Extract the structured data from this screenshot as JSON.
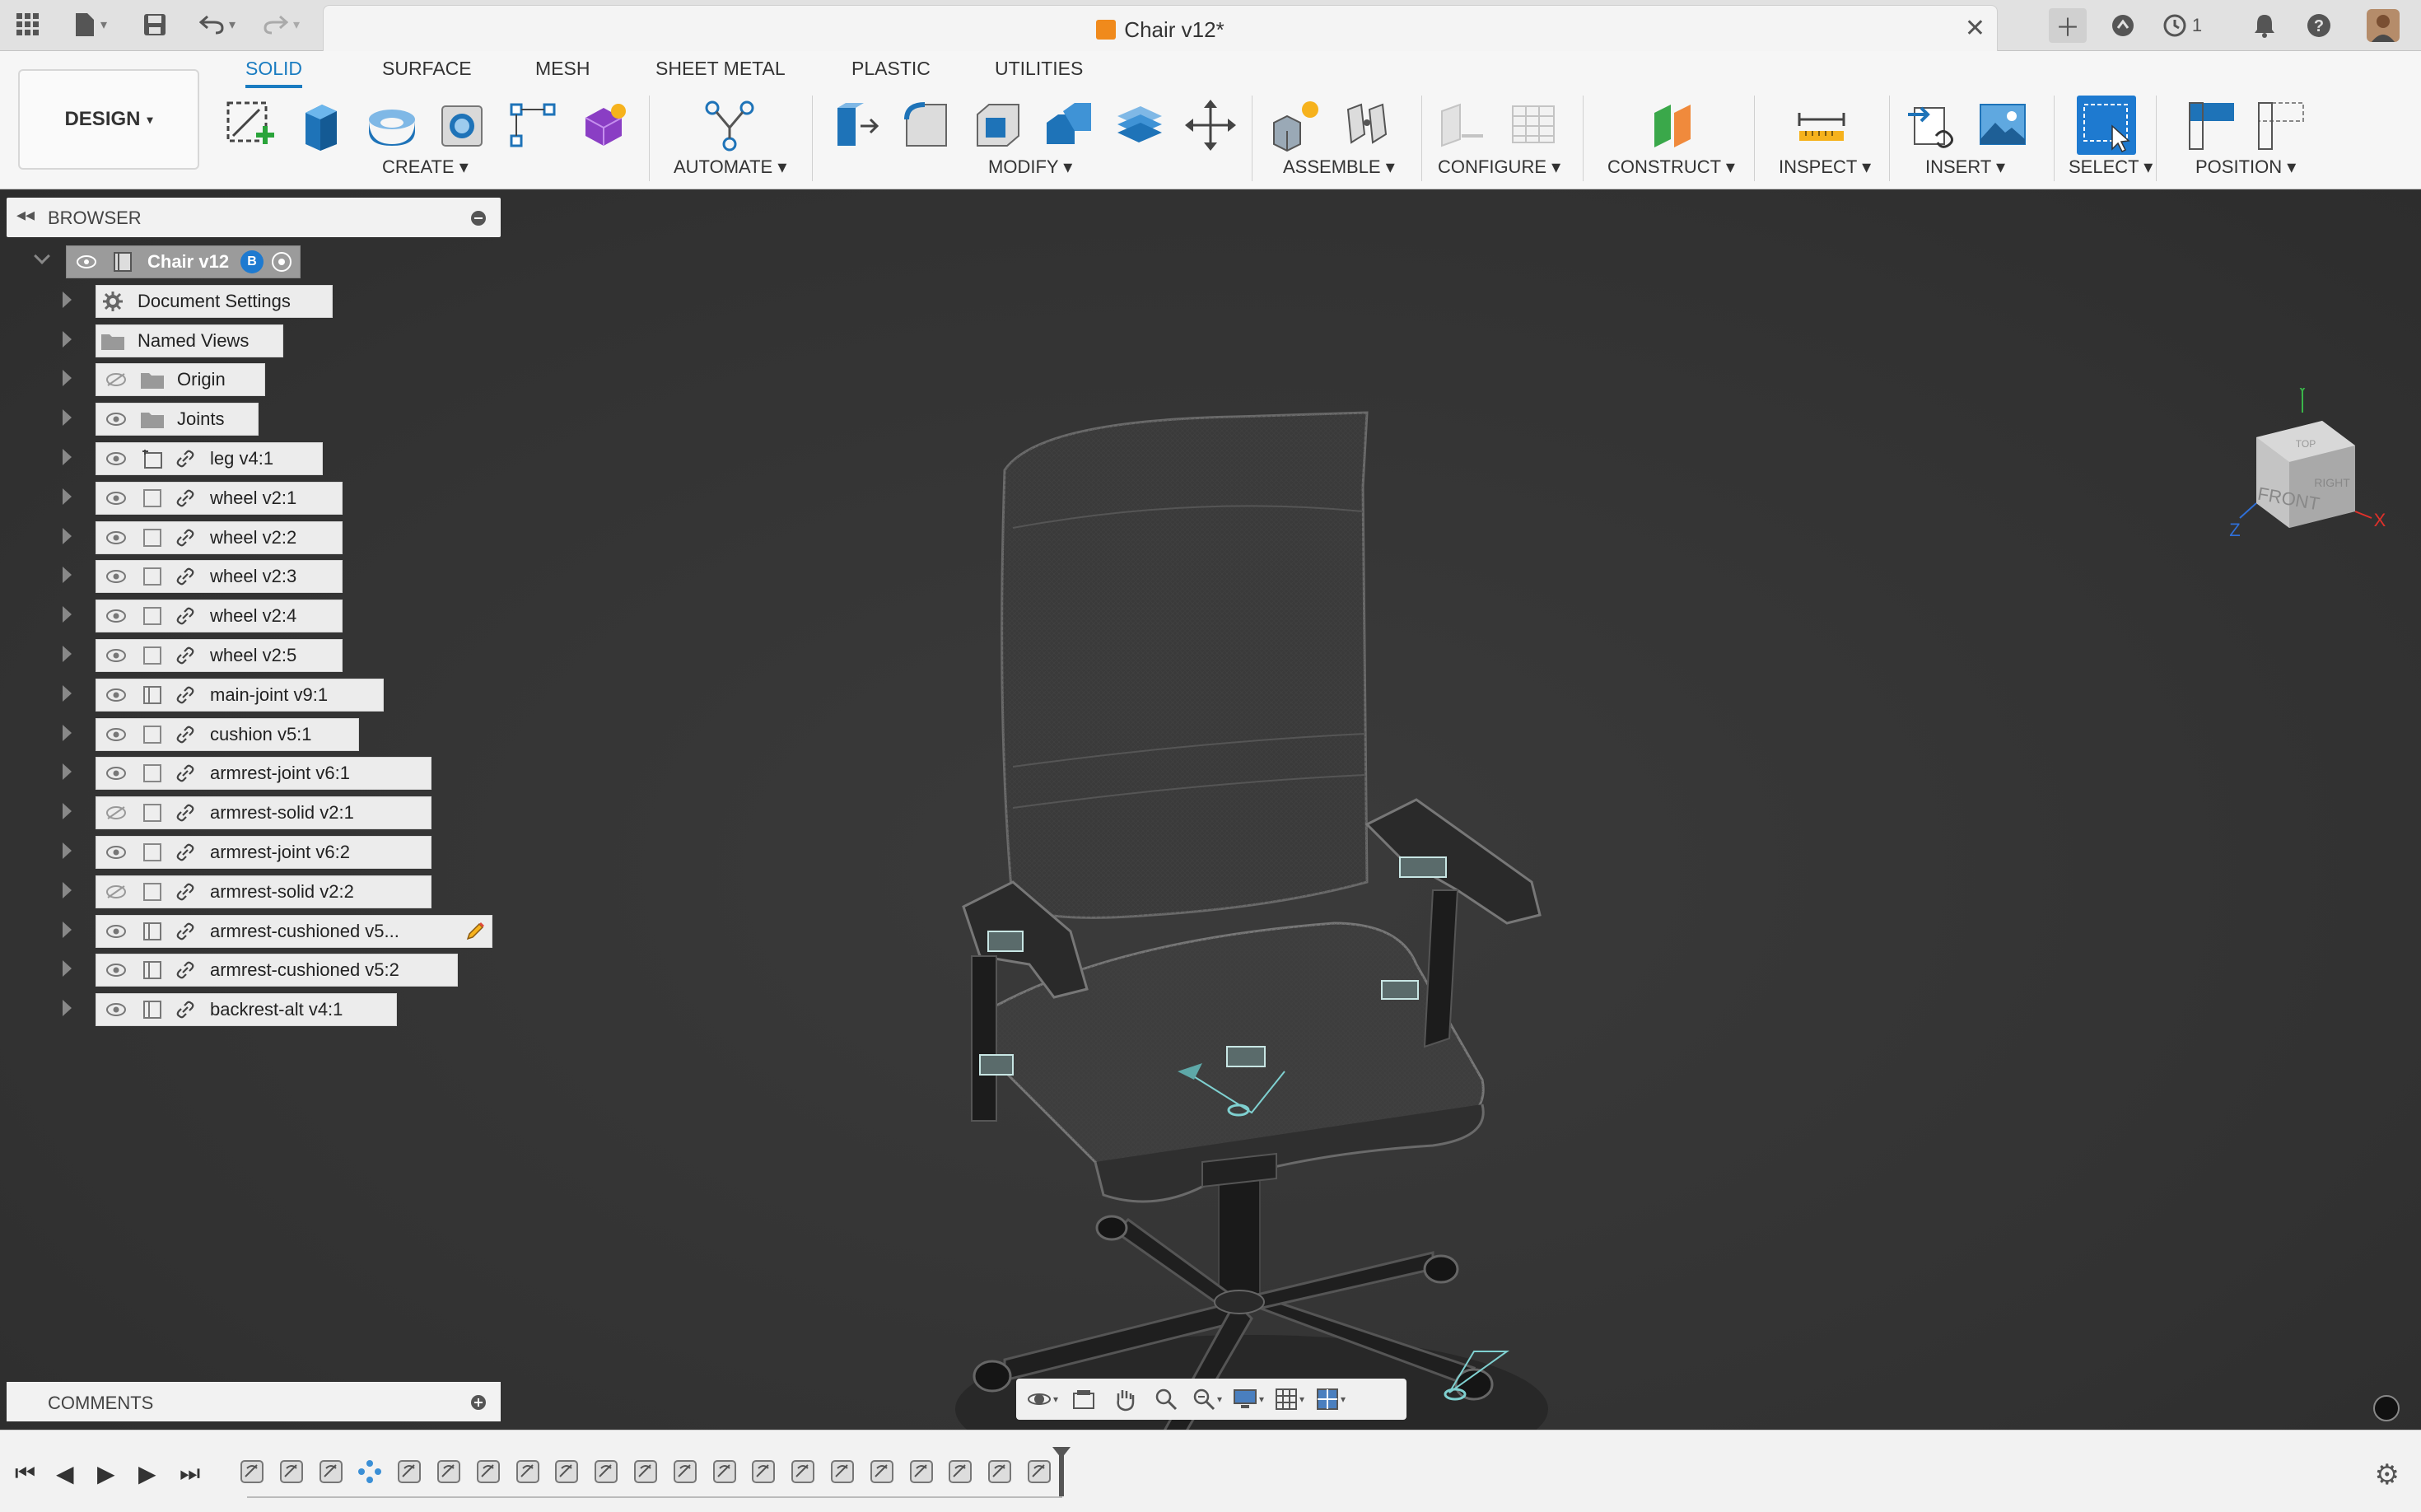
{
  "window": {
    "document_title": "Chair v12*"
  },
  "titlebar": {
    "left_icons": [
      "grid-menu-icon",
      "file-icon",
      "save-icon",
      "undo-icon",
      "redo-icon"
    ],
    "right_icons": [
      "new-tab-icon",
      "extensions-icon",
      "job-status-icon",
      "notifications-icon",
      "help-icon",
      "user-avatar"
    ],
    "job_count": "1"
  },
  "toolbar": {
    "workspace": "DESIGN",
    "tabs": [
      "SOLID",
      "SURFACE",
      "MESH",
      "SHEET METAL",
      "PLASTIC",
      "UTILITIES"
    ],
    "active_tab": "SOLID",
    "groups": {
      "create": "CREATE",
      "automate": "AUTOMATE",
      "modify": "MODIFY",
      "assemble": "ASSEMBLE",
      "configure": "CONFIGURE",
      "construct": "CONSTRUCT",
      "inspect": "INSPECT",
      "insert": "INSERT",
      "select": "SELECT",
      "position": "POSITION"
    }
  },
  "browser": {
    "title": "BROWSER",
    "root": "Chair v12",
    "root_badge": "B",
    "items": [
      {
        "label": "Document Settings",
        "type": "settings",
        "visible": null
      },
      {
        "label": "Named Views",
        "type": "folder",
        "visible": null
      },
      {
        "label": "Origin",
        "type": "folder",
        "visible": false
      },
      {
        "label": "Joints",
        "type": "folder",
        "visible": true
      },
      {
        "label": "leg v4:1",
        "type": "component-grounded",
        "visible": true
      },
      {
        "label": "wheel v2:1",
        "type": "body",
        "visible": true
      },
      {
        "label": "wheel v2:2",
        "type": "body",
        "visible": true
      },
      {
        "label": "wheel v2:3",
        "type": "body",
        "visible": true
      },
      {
        "label": "wheel v2:4",
        "type": "body",
        "visible": true
      },
      {
        "label": "wheel v2:5",
        "type": "body",
        "visible": true
      },
      {
        "label": "main-joint v9:1",
        "type": "component",
        "visible": true
      },
      {
        "label": "cushion v5:1",
        "type": "body",
        "visible": true
      },
      {
        "label": "armrest-joint v6:1",
        "type": "body",
        "visible": true
      },
      {
        "label": "armrest-solid v2:1",
        "type": "body",
        "visible": false
      },
      {
        "label": "armrest-joint v6:2",
        "type": "body",
        "visible": true
      },
      {
        "label": "armrest-solid v2:2",
        "type": "body",
        "visible": false
      },
      {
        "label": "armrest-cushioned v5...",
        "type": "component",
        "visible": true,
        "editing": true
      },
      {
        "label": "armrest-cushioned v5:2",
        "type": "component",
        "visible": true
      },
      {
        "label": "backrest-alt v4:1",
        "type": "component",
        "visible": true
      }
    ]
  },
  "viewcube": {
    "face_front": "FRONT",
    "face_right": "RIGHT",
    "face_top": "TOP",
    "axis_x": "X",
    "axis_y": "Y",
    "axis_z": "Z"
  },
  "comments": {
    "title": "COMMENTS"
  },
  "navbar": {
    "icons": [
      "orbit-icon",
      "look-at-icon",
      "pan-icon",
      "zoom-icon",
      "zoom-window-icon",
      "display-settings-icon",
      "grid-settings-icon",
      "viewports-icon"
    ]
  },
  "timeline": {
    "feature_count": 21
  },
  "colors": {
    "accent": "#1a7cc1",
    "viewport_bg": "#343434",
    "doc_icon": "#f08a1c"
  }
}
